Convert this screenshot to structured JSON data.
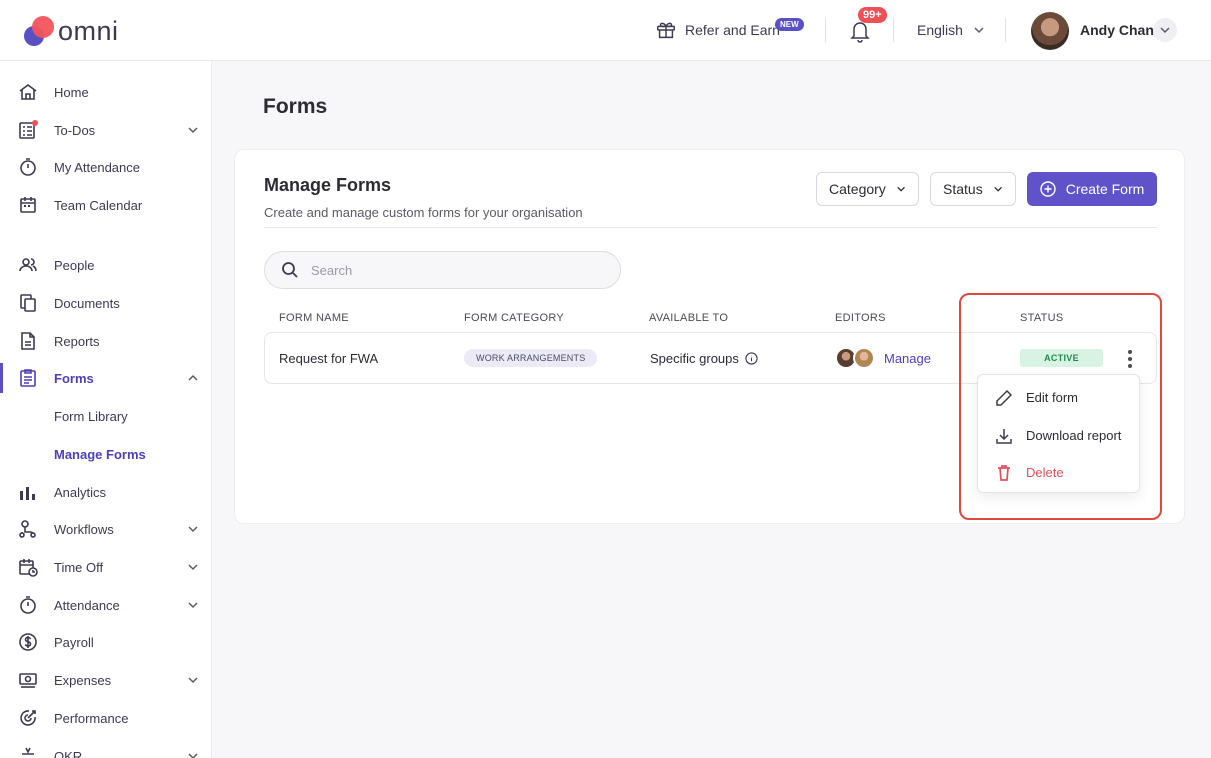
{
  "app": {
    "logo_text": "omni",
    "brand_color": "#5b4fc4",
    "accent_red": "#f2545b"
  },
  "topbar": {
    "refer_label": "Refer and Earn",
    "new_badge": "NEW",
    "notifications_count": "99+",
    "language": "English",
    "user_name": "Andy Chan"
  },
  "sidebar": {
    "items": [
      {
        "label": "Home"
      },
      {
        "label": "To-Dos"
      },
      {
        "label": "My Attendance"
      },
      {
        "label": "Team Calendar"
      },
      {
        "label": "People"
      },
      {
        "label": "Documents"
      },
      {
        "label": "Reports"
      },
      {
        "label": "Forms"
      },
      {
        "label": "Analytics"
      },
      {
        "label": "Workflows"
      },
      {
        "label": "Time Off"
      },
      {
        "label": "Attendance"
      },
      {
        "label": "Payroll"
      },
      {
        "label": "Expenses"
      },
      {
        "label": "Performance"
      },
      {
        "label": "OKR"
      }
    ],
    "forms_sub": [
      {
        "label": "Form Library"
      },
      {
        "label": "Manage Forms"
      }
    ]
  },
  "main": {
    "page_title": "Forms",
    "card": {
      "title": "Manage Forms",
      "subtitle": "Create and manage custom forms for your organisation",
      "category_filter": "Category",
      "status_filter": "Status",
      "create_button": "Create Form",
      "search_placeholder": "Search"
    },
    "table": {
      "headers": [
        "FORM NAME",
        "FORM CATEGORY",
        "AVAILABLE TO",
        "EDITORS",
        "STATUS"
      ],
      "rows": [
        {
          "form_name": "Request for FWA",
          "category": "WORK ARRANGEMENTS",
          "available_to": "Specific groups",
          "editors_link": "Manage",
          "status": "ACTIVE"
        }
      ]
    },
    "row_menu": {
      "items": [
        {
          "label": "Edit form"
        },
        {
          "label": "Download report"
        },
        {
          "label": "Delete"
        }
      ]
    }
  }
}
